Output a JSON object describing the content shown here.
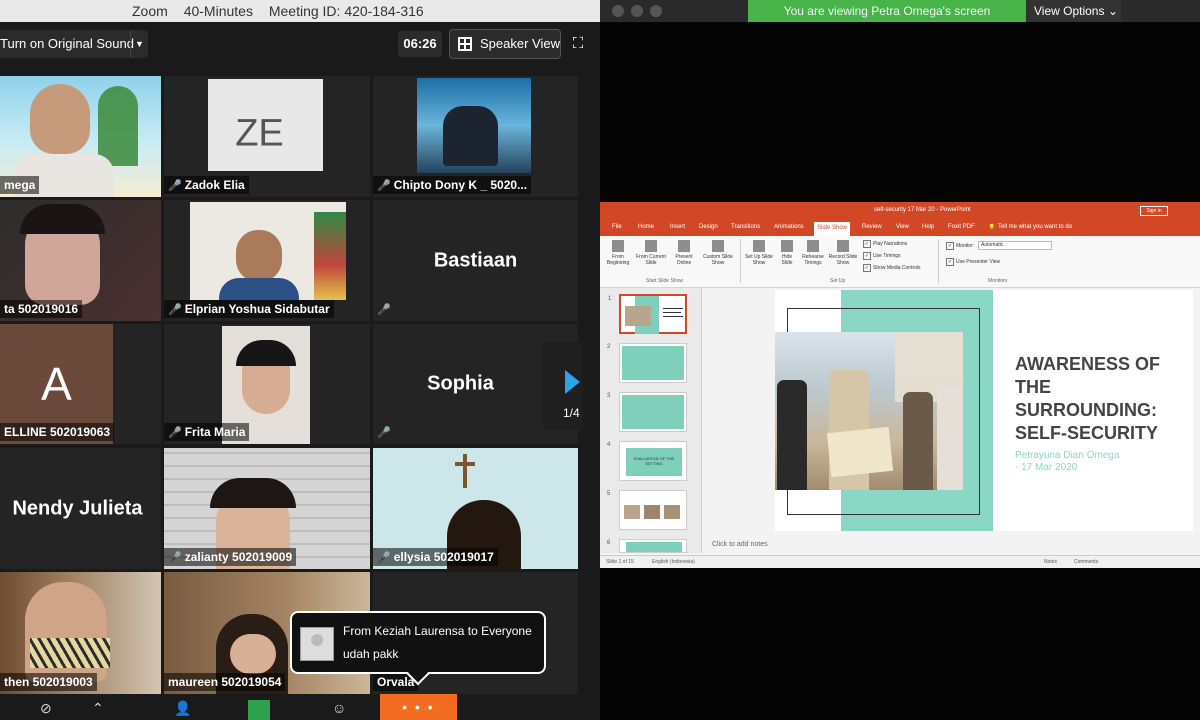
{
  "zoom": {
    "title_app": "Zoom",
    "title_meeting": "40-Minutes",
    "title_meeting_id": "Meeting ID: 420-184-316",
    "original_sound_label": "Turn on Original Sound",
    "timer": "06:26",
    "speaker_view_label": "Speaker View",
    "participants": [
      {
        "name": "mega",
        "muted": false
      },
      {
        "name": "Zadok Elia",
        "initials": "ZE",
        "muted": true
      },
      {
        "name": "Chipto Dony K _ 5020...",
        "muted": true
      },
      {
        "name": "ta 502019016",
        "muted": false
      },
      {
        "name": "Elprian Yoshua Sidabutar",
        "muted": true
      },
      {
        "name": "Bastiaan",
        "muted": true
      },
      {
        "name": "ELLINE 502019063",
        "initial": "A",
        "muted": false
      },
      {
        "name": "Frita Maria",
        "muted": true
      },
      {
        "name": "Sophia",
        "muted": true
      },
      {
        "name": "Nendy Julieta",
        "muted": false
      },
      {
        "name": "zalianty 502019009",
        "muted": true
      },
      {
        "name": "ellysia 502019017",
        "muted": true
      },
      {
        "name": "then 502019003",
        "muted": false
      },
      {
        "name": "maureen 502019054",
        "muted": false
      },
      {
        "name": "Orvala",
        "muted": false
      }
    ],
    "page_indicator": "1/4",
    "chat": {
      "from": "From Keziah Laurensa to Everyone",
      "message": "udah pakk"
    },
    "more_label": "• • •"
  },
  "share": {
    "viewing_banner": "You are viewing Petra Omega's screen",
    "view_options_label": "View Options ⌄",
    "powerpoint": {
      "title": "self-security 17 Mar 20 - PowerPoint",
      "sign_in": "Sign in",
      "tabs": [
        "File",
        "Home",
        "Insert",
        "Design",
        "Transitions",
        "Animations",
        "Slide Show",
        "Review",
        "View",
        "Help",
        "Foxit PDF"
      ],
      "tell_me": "Tell me what you want to do",
      "ribbon": {
        "from_beginning": "From Beginning",
        "from_current": "From Current Slide",
        "present_online": "Present Online",
        "custom_show": "Custom Slide Show",
        "group_start": "Start Slide Show",
        "set_up": "Set Up Slide Show",
        "hide_slide": "Hide Slide",
        "rehearse": "Rehearse Timings",
        "record": "Record Slide Show",
        "play_narrations": "Play Narrations",
        "use_timings": "Use Timings",
        "show_media": "Show Media Controls",
        "group_setup": "Set Up",
        "monitor_label": "Monitor:",
        "monitor_value": "Automatic",
        "presenter_view": "Use Presenter View",
        "group_monitors": "Monitors"
      },
      "slide_numbers": [
        "1",
        "2",
        "3",
        "4",
        "5",
        "6"
      ],
      "thumb4_text": "EVALUATION OF THE SETTING",
      "slide": {
        "heading_lines": [
          "AWARENESS OF",
          "THE",
          "SURROUNDING:",
          "SELF-SECURITY"
        ],
        "author_line1": "Petrayuna Dian Omega",
        "author_line2": "- 17 Mar 2020"
      },
      "notes_placeholder": "Click to add notes",
      "status": {
        "slide_of": "Slide 1 of 15",
        "language": "English (Indonesia)",
        "notes": "Notes",
        "comments": "Comments"
      }
    },
    "colors": {
      "ppt_accent": "#d24726",
      "slide_teal": "#8ad7c5",
      "banner_green": "#47b349",
      "zoom_orange": "#f26d21",
      "active_speaker": "#e8d53d"
    }
  }
}
